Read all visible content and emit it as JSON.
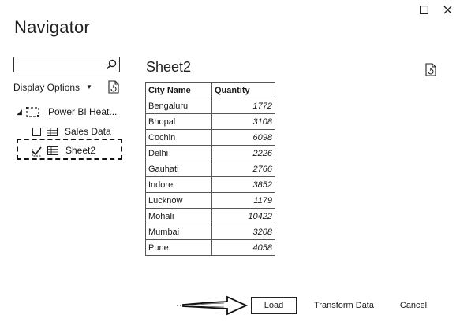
{
  "window": {
    "title": "Navigator"
  },
  "search": {
    "value": "",
    "placeholder": ""
  },
  "display_options": {
    "label": "Display Options"
  },
  "tree": {
    "root": {
      "label": "Power BI Heat..."
    },
    "items": [
      {
        "label": "Sales Data",
        "checked": false
      },
      {
        "label": "Sheet2",
        "checked": true
      }
    ]
  },
  "preview": {
    "title": "Sheet2",
    "columns": [
      "City Name",
      "Quantity"
    ],
    "rows": [
      [
        "Bengaluru",
        "1772"
      ],
      [
        "Bhopal",
        "3108"
      ],
      [
        "Cochin",
        "6098"
      ],
      [
        "Delhi",
        "2226"
      ],
      [
        "Gauhati",
        "2766"
      ],
      [
        "Indore",
        "3852"
      ],
      [
        "Lucknow",
        "1179"
      ],
      [
        "Mohali",
        "10422"
      ],
      [
        "Mumbai",
        "3208"
      ],
      [
        "Pune",
        "4058"
      ]
    ]
  },
  "footer": {
    "load_label": "Load",
    "transform_label": "Transform Data",
    "cancel_label": "Cancel"
  }
}
